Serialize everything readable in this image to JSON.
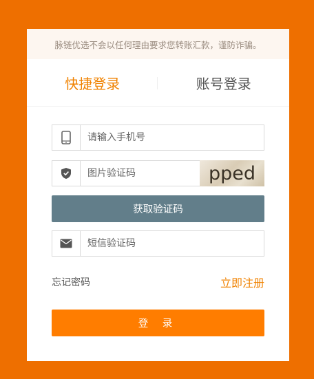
{
  "notice": "脉链优选不会以任何理由要求您转账汇款，谨防诈骗。",
  "tabs": {
    "quick_login": "快捷登录",
    "account_login": "账号登录"
  },
  "form": {
    "phone_placeholder": "请输入手机号",
    "captcha_placeholder": "图片验证码",
    "captcha_text": "pped",
    "get_code_label": "获取验证码",
    "sms_placeholder": "短信验证码"
  },
  "links": {
    "forgot": "忘记密码",
    "register": "立即注册"
  },
  "login_label": "登 录",
  "colors": {
    "background": "#ee6f00",
    "accent": "#f08200",
    "login_button": "#ff7d00",
    "code_button": "#627e8a"
  },
  "icons": [
    "phone-icon",
    "shield-icon",
    "mail-icon"
  ]
}
